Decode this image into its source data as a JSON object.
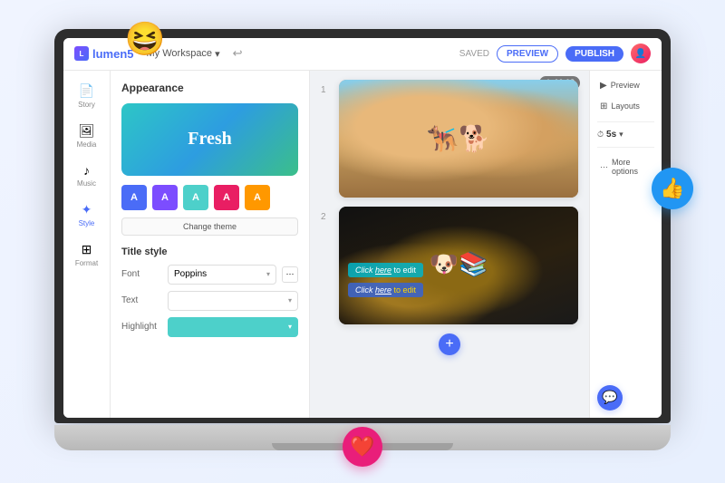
{
  "app": {
    "brand": "lumen5",
    "workspace": "My Workspace",
    "saved": "SAVED",
    "preview_btn": "PREVIEW",
    "publish_btn": "PUBLISH",
    "timer": "00:08",
    "undo_icon": "↩"
  },
  "sidebar": {
    "items": [
      {
        "id": "story",
        "label": "Story",
        "icon": "📄"
      },
      {
        "id": "media",
        "label": "Media",
        "icon": "🖼"
      },
      {
        "id": "music",
        "label": "Music",
        "icon": "♪"
      },
      {
        "id": "style",
        "label": "Style",
        "icon": "✦"
      },
      {
        "id": "format",
        "label": "Format",
        "icon": "⊞"
      }
    ]
  },
  "panel": {
    "appearance_title": "Appearance",
    "theme_text": "Fresh",
    "swatches": [
      {
        "color": "#4a6cf7",
        "label": "A"
      },
      {
        "color": "#7c4dff",
        "label": "A"
      },
      {
        "color": "#4dd0ca",
        "label": "A"
      },
      {
        "color": "#e91e63",
        "label": "A"
      },
      {
        "color": "#ff9800",
        "label": "A"
      }
    ],
    "change_theme_btn": "Change theme",
    "title_style_section": "Title style",
    "font_label": "Font",
    "font_value": "Poppins",
    "text_label": "Text",
    "highlight_label": "Highlight",
    "highlight_color": "#4dd0ca"
  },
  "canvas": {
    "slide1_num": "1",
    "slide2_num": "2",
    "slide1_emoji": "🐕",
    "slide2_dog_emoji": "🐶",
    "click_here_edit_1": "Click here to edit",
    "click_here_edit_2": "Click here to edit",
    "add_btn": "+"
  },
  "right_panel": {
    "preview": "Preview",
    "layouts": "Layouts",
    "timing": "5s",
    "more_options": "More options",
    "chat_icon": "💬"
  },
  "floats": {
    "laugh_emoji": "😆",
    "thumbs_emoji": "👍",
    "heart_emoji": "❤️"
  }
}
